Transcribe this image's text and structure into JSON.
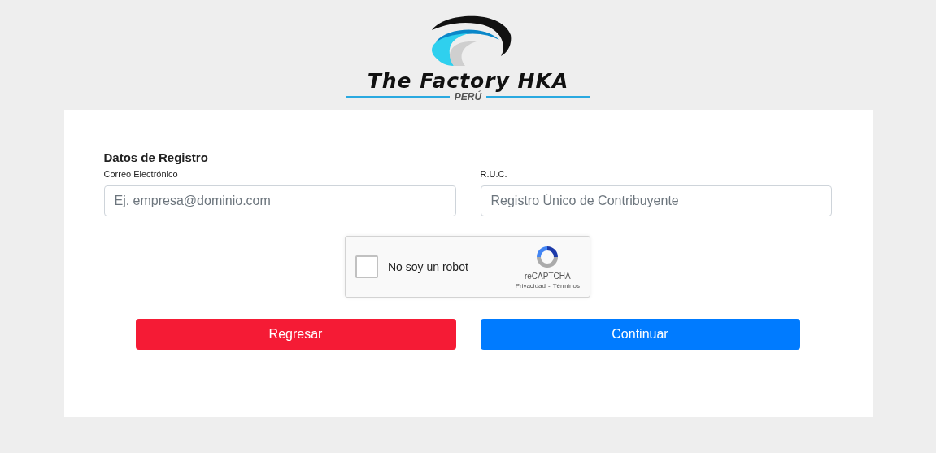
{
  "logo": {
    "name": "The Factory HKA",
    "country": "PERÚ"
  },
  "form": {
    "title": "Datos de Registro",
    "fields": [
      {
        "label": "Correo Electrónico",
        "placeholder": "Ej. empresa@dominio.com"
      },
      {
        "label": "R.U.C.",
        "placeholder": "Registro Único de Contribuyente"
      }
    ],
    "captcha": {
      "label": "No soy un robot",
      "checked": false,
      "brand": "reCAPTCHA",
      "links": [
        "Privacidad",
        "Términos"
      ],
      "separator": "-"
    },
    "buttons": [
      {
        "label": "Regresar",
        "kind": "danger"
      },
      {
        "label": "Continuar",
        "kind": "primary"
      }
    ]
  }
}
